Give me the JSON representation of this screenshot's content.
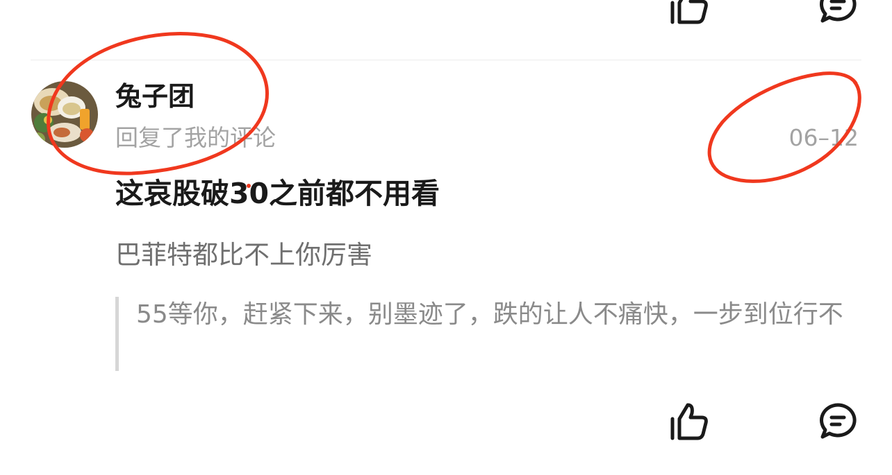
{
  "colors": {
    "text_primary": "#1a1a1a",
    "text_secondary": "#a3a3a3",
    "text_body": "#6f6f6f",
    "quote_text": "#8a8a8a",
    "quote_bar": "#d6d6d6",
    "annotation_circle": "#f0381e"
  },
  "comment": {
    "avatar_icon": "food-photo-avatar",
    "username": "兔子团",
    "action": "回复了我的评论",
    "timestamp": "06–12",
    "reply": "这哀股破30之前都不用看",
    "title": "巴菲特都比不上你厉害",
    "quoted": "55等你，赶紧下来，别墨迹了，跌的让人不痛快，一步到位行不"
  },
  "actions": {
    "like_icon": "thumbs-up-icon",
    "reply_icon": "comment-bubble-icon"
  }
}
